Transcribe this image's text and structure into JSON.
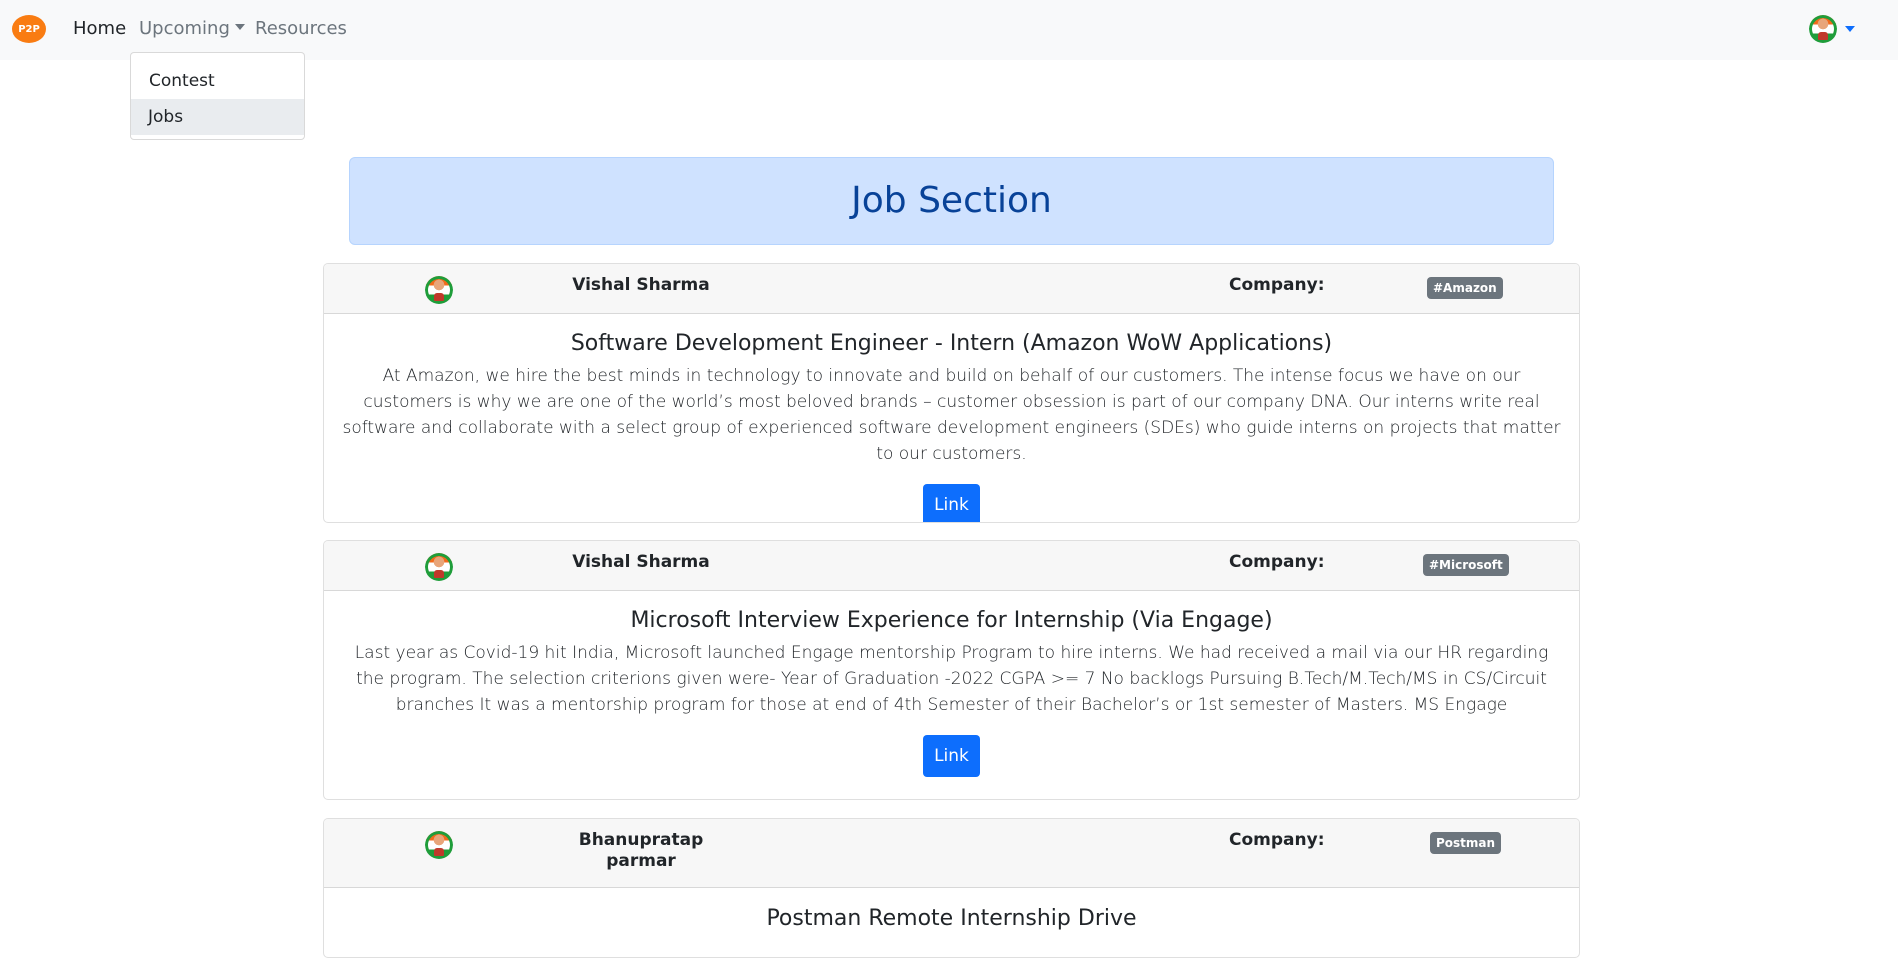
{
  "navbar": {
    "brand": "P2P",
    "links": {
      "home": "Home",
      "upcoming": "Upcoming",
      "resources": "Resources"
    }
  },
  "dropdown": {
    "items": [
      "Contest",
      "Jobs"
    ]
  },
  "section": {
    "title": "Job Section"
  },
  "jobs": [
    {
      "author": "Vishal Sharma",
      "company_label": "Company:",
      "company_tag": "#Amazon",
      "title": "Software Development Engineer - Intern (Amazon WoW Applications)",
      "description": "At Amazon, we hire the best minds in technology to innovate and build on behalf of our customers. The intense focus we have on our customers is why we are one of the world’s most beloved brands – customer obsession is part of our company DNA. Our interns write real software and collaborate with a select group of experienced software development engineers (SDEs) who guide interns on projects that matter to our customers.",
      "link_label": "Link"
    },
    {
      "author": "Vishal Sharma",
      "company_label": "Company:",
      "company_tag": "#Microsoft",
      "title": "Microsoft Interview Experience for Internship (Via Engage)",
      "description": "Last year as Covid-19 hit India, Microsoft launched Engage mentorship Program to hire interns. We had received a mail via our HR regarding the program. The selection criterions given were- Year of Graduation -2022 CGPA >= 7 No backlogs Pursuing B.Tech/M.Tech/MS in CS/Circuit branches It was a mentorship program for those at end of 4th Semester of their Bachelor’s or 1st semester of Masters. MS Engage",
      "link_label": "Link"
    },
    {
      "author": "Bhanupratap parmar",
      "company_label": "Company:",
      "company_tag": "Postman",
      "title": "Postman Remote Internship Drive"
    }
  ]
}
